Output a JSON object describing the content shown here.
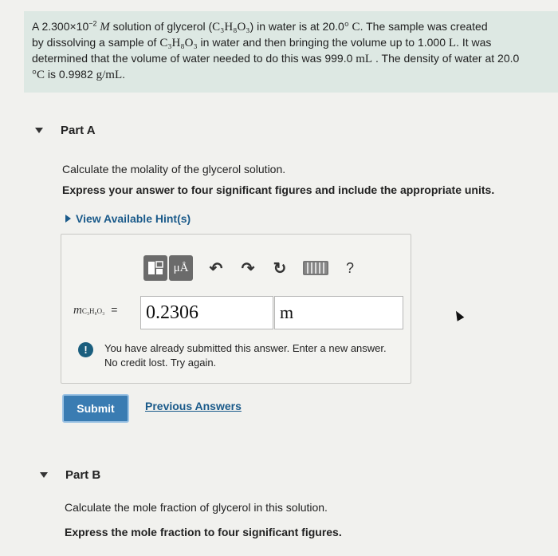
{
  "intro": {
    "t1": "A 2.300×10",
    "exp": "−2",
    "t2": " M",
    "t3": " solution of glycerol (",
    "formula": "C₃H₈O₃",
    "t4": ") in water is at 20.0",
    "t5": "° C",
    "t6": ". The sample was created",
    "l2a": "by dissolving a sample of ",
    "l2b": " in water and then bringing the volume up to 1.000 ",
    "l2c": "L",
    "l2d": ". It was",
    "l3a": "determined that the volume of water needed to do this was 999.0 ",
    "l3b": "mL",
    "l3c": " . The density of water at 20.0",
    "l4a": "°C",
    "l4b": " is 0.9982 ",
    "l4c": "g/mL",
    "l4d": "."
  },
  "partA": {
    "title": "Part A",
    "question": "Calculate the molality of the glycerol solution.",
    "instruction": "Express your answer to four significant figures and include the appropriate units.",
    "hint_label": "View Available Hint(s)",
    "toolbar": {
      "mu_label": "μÅ",
      "undo_icon": "undo-icon",
      "redo_icon": "redo-icon",
      "reset_icon": "reset-icon",
      "help_label": "?"
    },
    "variable": "m",
    "variable_sub": "C₃H₈O₃",
    "equals": "=",
    "value": "0.2306",
    "unit": "m",
    "notice_icon": "!",
    "notice_line1": "You have already submitted this answer. Enter a new answer.",
    "notice_line2": "No credit lost. Try again.",
    "submit_label": "Submit",
    "previous_label": "Previous Answers"
  },
  "partB": {
    "title": "Part B",
    "question": "Calculate the mole fraction of glycerol in this solution.",
    "instruction": "Express the mole fraction to four significant figures."
  },
  "colors": {
    "intro_bg": "#dde8e3",
    "link": "#1a5a8a",
    "submit": "#3a7cb2"
  }
}
